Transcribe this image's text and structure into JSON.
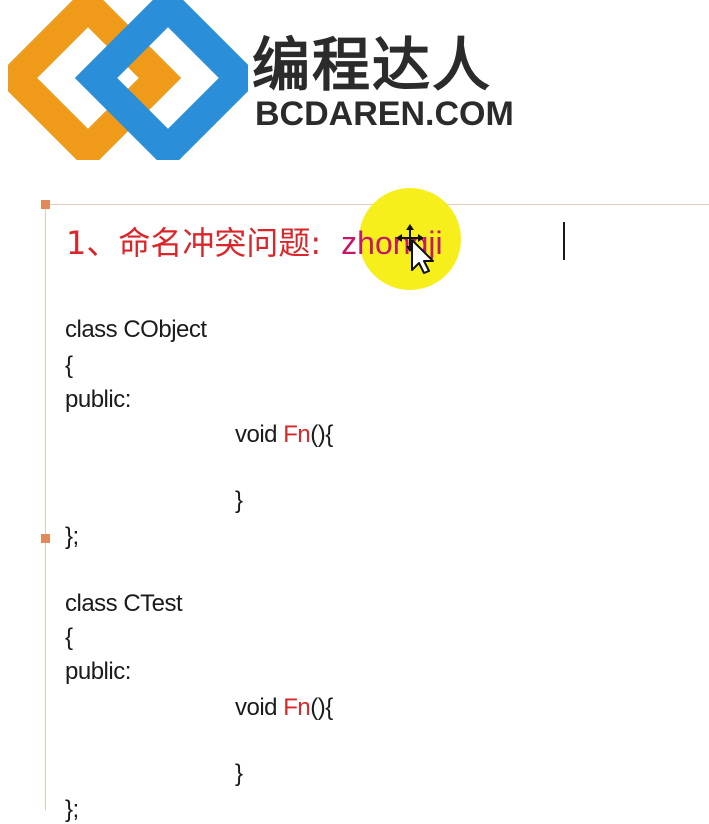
{
  "brand": {
    "name_cn": "编程达人",
    "domain": "BCDAREN.COM",
    "colors": {
      "orange": "#f09a1a",
      "blue": "#2a8fd8",
      "text": "#2b2b2b"
    }
  },
  "heading": {
    "number": "1",
    "separator": "、",
    "title": "命名冲突问题",
    "colon": ":",
    "term": "zhongji",
    "color": "#d8262a"
  },
  "cursor": {
    "type": "move-cursor-icon",
    "highlight_color": "#f6ef1c"
  },
  "code": {
    "block1": {
      "decl": "class CObject",
      "open_brace": "{",
      "access": "public:",
      "method_prefix": "void ",
      "method_name": "Fn",
      "method_suffix": "(){",
      "method_close": "}",
      "close": "};"
    },
    "block2": {
      "decl": "class CTest",
      "open_brace": "{",
      "access": "public:",
      "method_prefix": "void ",
      "method_name": "Fn",
      "method_suffix": "(){",
      "method_close": "}",
      "close": "};"
    }
  }
}
